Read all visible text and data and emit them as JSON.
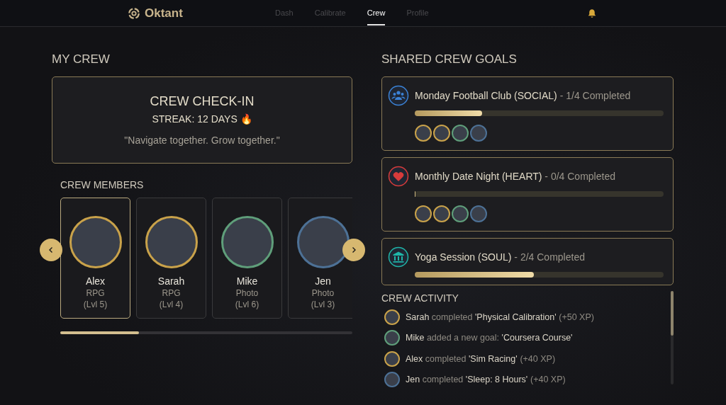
{
  "nav": {
    "brand": "Oktant",
    "tabs": [
      {
        "label": "Dash",
        "selected": false
      },
      {
        "label": "Calibrate",
        "selected": false
      },
      {
        "label": "Crew",
        "selected": true
      },
      {
        "label": "Profile",
        "selected": false
      }
    ]
  },
  "my_crew": {
    "title": "MY CREW",
    "checkin": {
      "title": "CREW CHECK-IN",
      "streak": "STREAK: 12 DAYS 🔥",
      "quote": "\"Navigate together. Grow together.\""
    },
    "members_title": "CREW MEMBERS",
    "members": [
      {
        "name": "Alex",
        "type": "RPG",
        "level": "(Lvl 5)",
        "selected": true,
        "color": "#c9a24a"
      },
      {
        "name": "Sarah",
        "type": "RPG",
        "level": "(Lvl 4)",
        "selected": false,
        "color": "#c9a24a"
      },
      {
        "name": "Mike",
        "type": "Photo",
        "level": "(Lvl 6)",
        "selected": false,
        "color": "#5f9e7a"
      },
      {
        "name": "Jen",
        "type": "Photo",
        "level": "(Lvl 3)",
        "selected": false,
        "color": "#4d7196"
      }
    ]
  },
  "goals": {
    "title": "SHARED CREW GOALS",
    "items": [
      {
        "kind": "social",
        "color": "#3b82d6",
        "name": "Monday Football Club (SOCIAL)",
        "progress": "- 1/4 Completed",
        "level": 0.27,
        "participants": [
          {
            "color": "#c9a24a"
          },
          {
            "color": "#c9a24a"
          },
          {
            "color": "#5f9e7a"
          },
          {
            "color": "#4d7196"
          }
        ]
      },
      {
        "kind": "heart",
        "color": "#d63b3b",
        "name": "Monthly Date Night (HEART)",
        "progress": "- 0/4 Completed",
        "level": 0,
        "participants": [
          {
            "color": "#c9a24a"
          },
          {
            "color": "#c9a24a"
          },
          {
            "color": "#5f9e7a"
          },
          {
            "color": "#4d7196"
          }
        ]
      },
      {
        "kind": "soul",
        "color": "#1fb5a8",
        "name": "Yoga Session (SOUL)",
        "progress": "- 2/4 Completed",
        "level": 0.48
      }
    ]
  },
  "activity": {
    "title": "CREW ACTIVITY",
    "items": [
      {
        "color": "#c9a24a",
        "actor": "Sarah",
        "action": "completed",
        "target": "'Physical Calibration'",
        "xp": "(+50 XP)"
      },
      {
        "color": "#5f9e7a",
        "actor": "Mike",
        "action": "added a new goal:",
        "target": "'Coursera Course'"
      },
      {
        "color": "#c9a24a",
        "actor": "Alex",
        "action": "completed",
        "target": "'Sim Racing'",
        "xp": "(+40 XP)"
      },
      {
        "color": "#4d7196",
        "actor": "Jen",
        "action": "completed",
        "target": "'Sleep: 8 Hours'",
        "xp": "(+40 XP)"
      }
    ]
  }
}
